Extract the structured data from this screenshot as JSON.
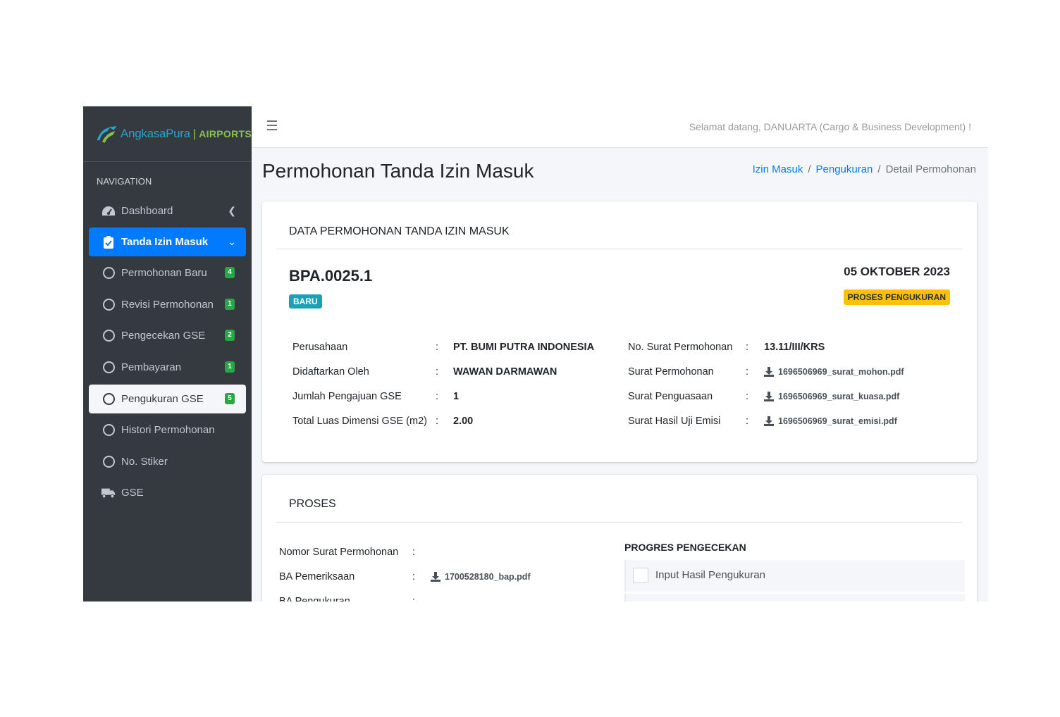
{
  "brand": {
    "name": "AngkasaPura",
    "separator": "|",
    "suffix": "AIRPORTS"
  },
  "sidebar": {
    "header": "NAVIGATION",
    "items": [
      {
        "label": "Dashboard",
        "icon": "tachometer-icon"
      },
      {
        "label": "Tanda Izin Masuk",
        "icon": "clipboard-check-icon"
      },
      {
        "label": "Permohonan Baru",
        "badge": "4"
      },
      {
        "label": "Revisi Permohonan",
        "badge": "1"
      },
      {
        "label": "Pengecekan GSE",
        "badge": "2"
      },
      {
        "label": "Pembayaran",
        "badge": "1"
      },
      {
        "label": "Pengukuran GSE",
        "badge": "5"
      },
      {
        "label": "Histori Permohonan"
      },
      {
        "label": "No. Stiker"
      },
      {
        "label": "GSE",
        "icon": "truck-icon"
      }
    ]
  },
  "topbar": {
    "welcome": "Selamat datang, DANUARTA (Cargo & Business Development) !"
  },
  "page": {
    "title": "Permohonan Tanda Izin Masuk",
    "breadcrumb": {
      "item1": "Izin Masuk",
      "item2": "Pengukuran",
      "current": "Detail Permohonan",
      "divider": "/"
    }
  },
  "detail": {
    "header": "DATA PERMOHONAN TANDA IZIN MASUK",
    "number": "BPA.0025.1",
    "date": "05 OKTOBER 2023",
    "status_badge": "BARU",
    "process_badge": "PROSES PENGUKURAN",
    "colon": ":",
    "left": [
      {
        "label": "Perusahaan",
        "value": "PT. BUMI PUTRA INDONESIA"
      },
      {
        "label": "Didaftarkan Oleh",
        "value": "WAWAN DARMAWAN"
      },
      {
        "label": "Jumlah Pengajuan GSE",
        "value": "1"
      },
      {
        "label": "Total Luas Dimensi GSE (m2)",
        "value": "2.00"
      }
    ],
    "right": [
      {
        "label": "No. Surat Permohonan",
        "value": "13.11/III/KRS"
      },
      {
        "label": "Surat Permohonan",
        "file": "1696506969_surat_mohon.pdf"
      },
      {
        "label": "Surat Penguasaan",
        "file": "1696506969_surat_kuasa.pdf"
      },
      {
        "label": "Surat Hasil Uji Emisi",
        "file": "1696506969_surat_emisi.pdf"
      }
    ]
  },
  "proses": {
    "header": "PROSES",
    "rows": [
      {
        "label": "Nomor Surat Permohonan",
        "value": ""
      },
      {
        "label": "BA Pemeriksaan",
        "file": "1700528180_bap.pdf"
      },
      {
        "label": "BA Pengukuran",
        "value": ""
      }
    ],
    "progress_title": "PROGRES PENGECEKAN",
    "checks": [
      {
        "label": "Input Hasil Pengukuran"
      },
      {
        "label": ""
      }
    ]
  }
}
